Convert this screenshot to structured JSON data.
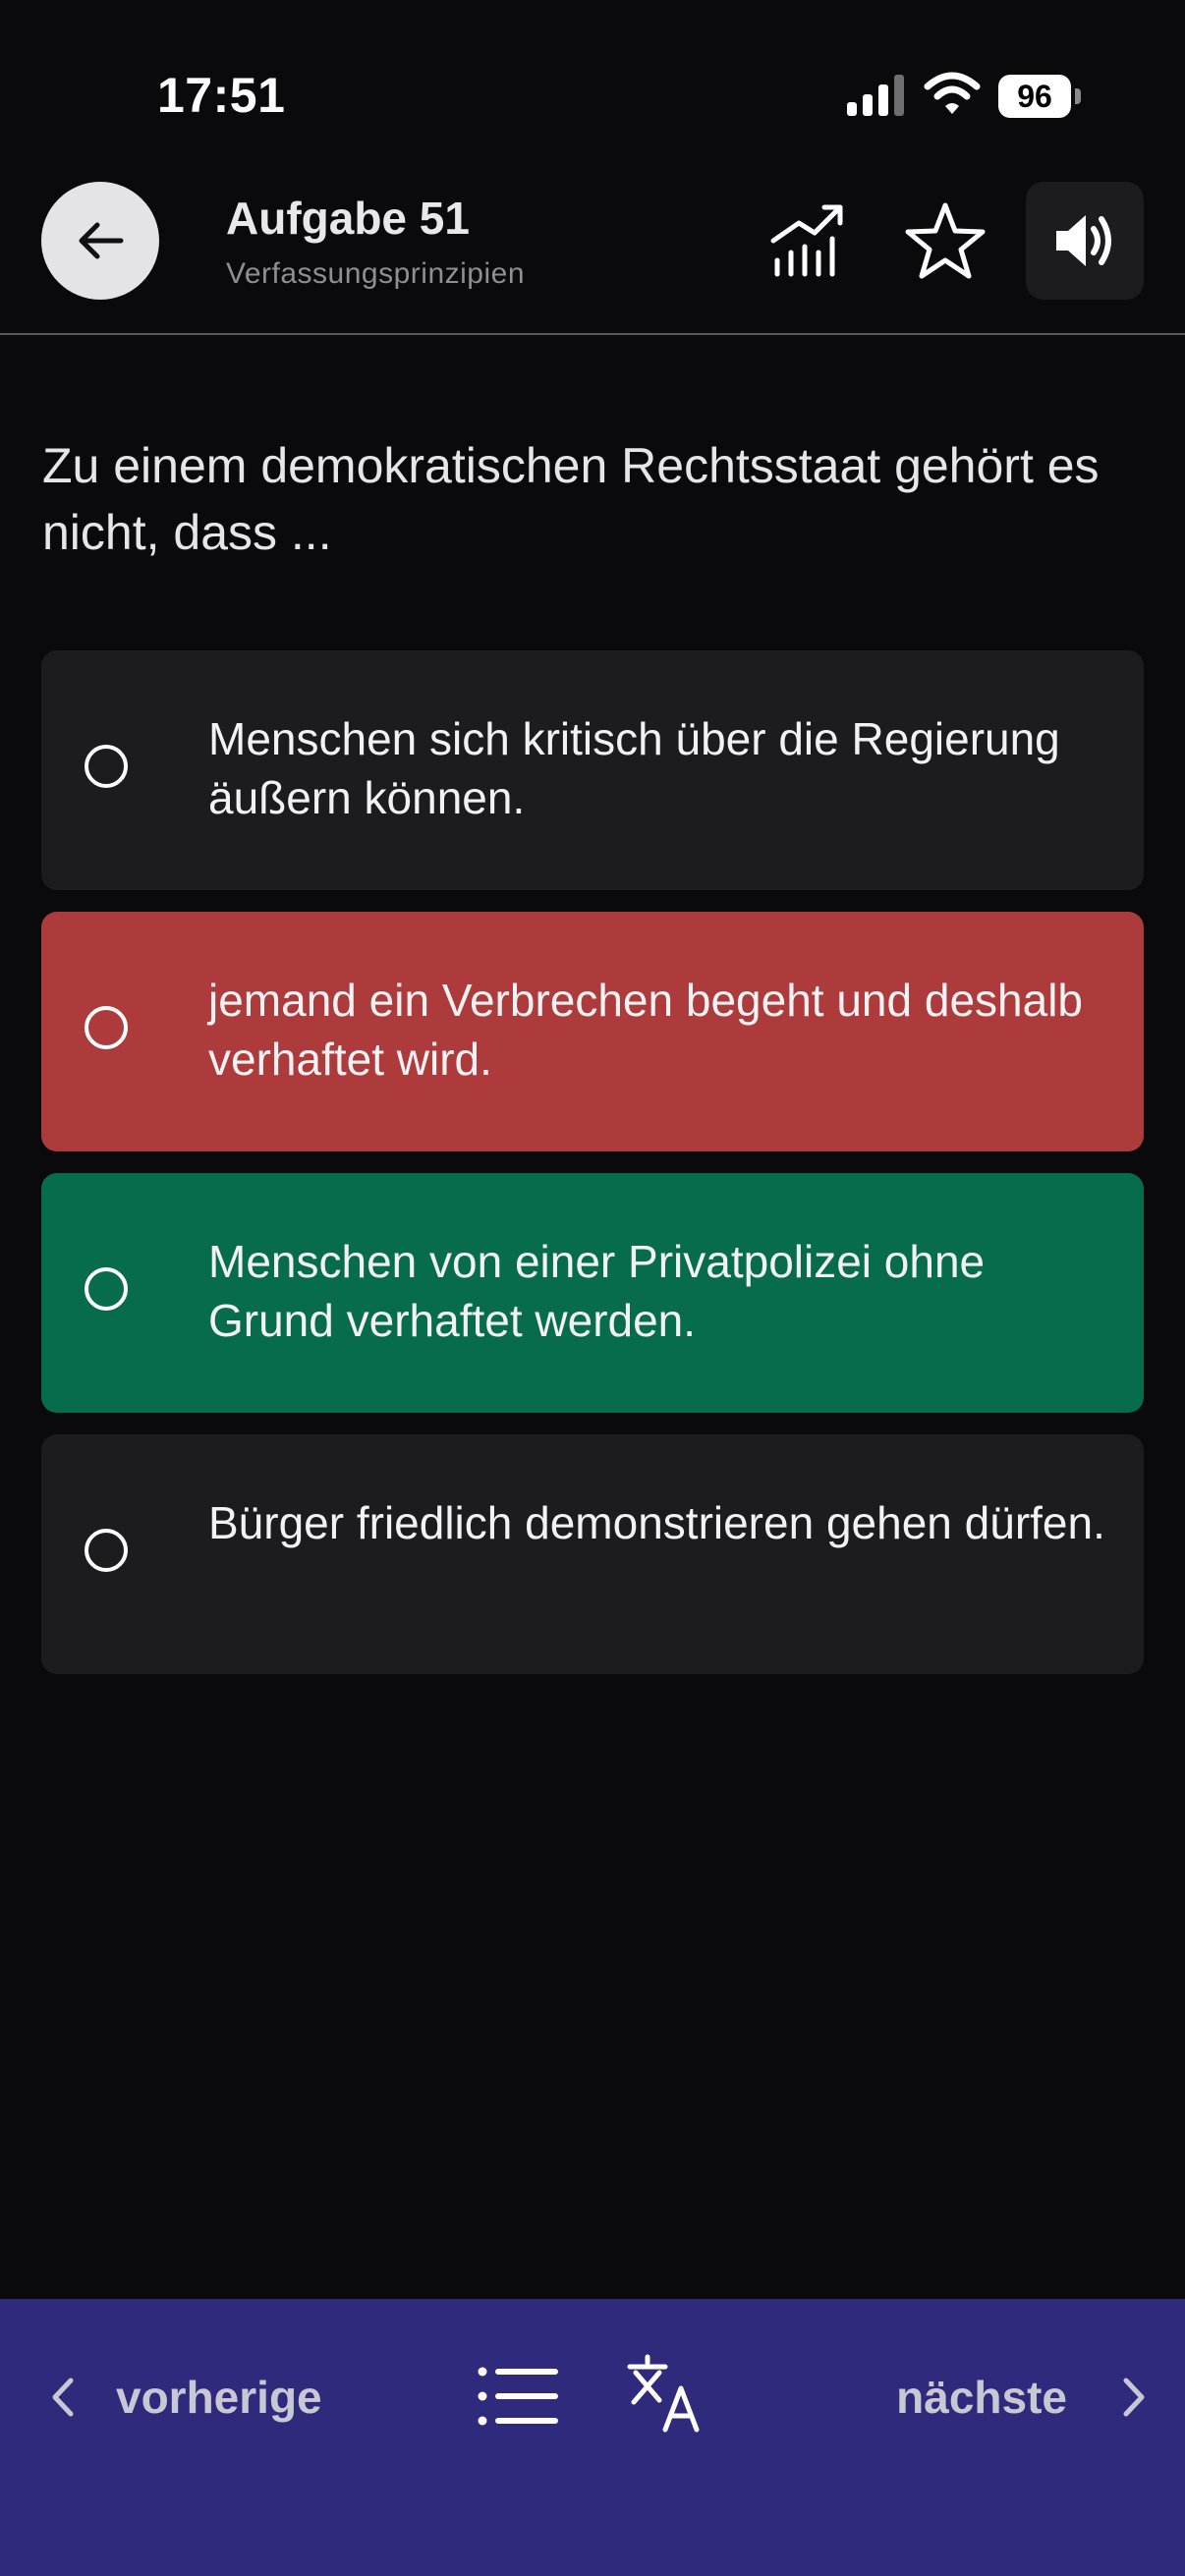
{
  "status_bar": {
    "time": "17:51",
    "battery": "96",
    "icons": [
      "cellular-signal-icon",
      "wifi-icon",
      "battery-icon"
    ]
  },
  "header": {
    "title": "Aufgabe 51",
    "subtitle": "Verfassungsprinzipien",
    "icons": [
      "arrow-left-icon",
      "statistics-icon",
      "star-icon",
      "speaker-icon"
    ]
  },
  "question": {
    "text": "Zu einem demokratischen Rechtsstaat gehört es nicht, dass ..."
  },
  "answers": [
    {
      "text": "Menschen sich kritisch über die Regierung äußern können.",
      "state": "neutral"
    },
    {
      "text": "jemand ein Verbrechen begeht und deshalb verhaftet wird.",
      "state": "wrong"
    },
    {
      "text": "Menschen von einer Privatpolizei ohne Grund verhaftet werden.",
      "state": "correct"
    },
    {
      "text": "Bürger friedlich demonstrieren gehen dürfen.",
      "state": "neutral"
    }
  ],
  "bottom_nav": {
    "prev_label": "vorherige",
    "next_label": "nächste",
    "icons": [
      "chevron-left-icon",
      "list-icon",
      "translate-icon",
      "chevron-right-icon"
    ]
  },
  "colors": {
    "background": "#0a0a0c",
    "card": "#1c1c1e",
    "wrong": "#ae3b3c",
    "correct": "#076c4b",
    "bottom_bar": "#302a7c"
  }
}
